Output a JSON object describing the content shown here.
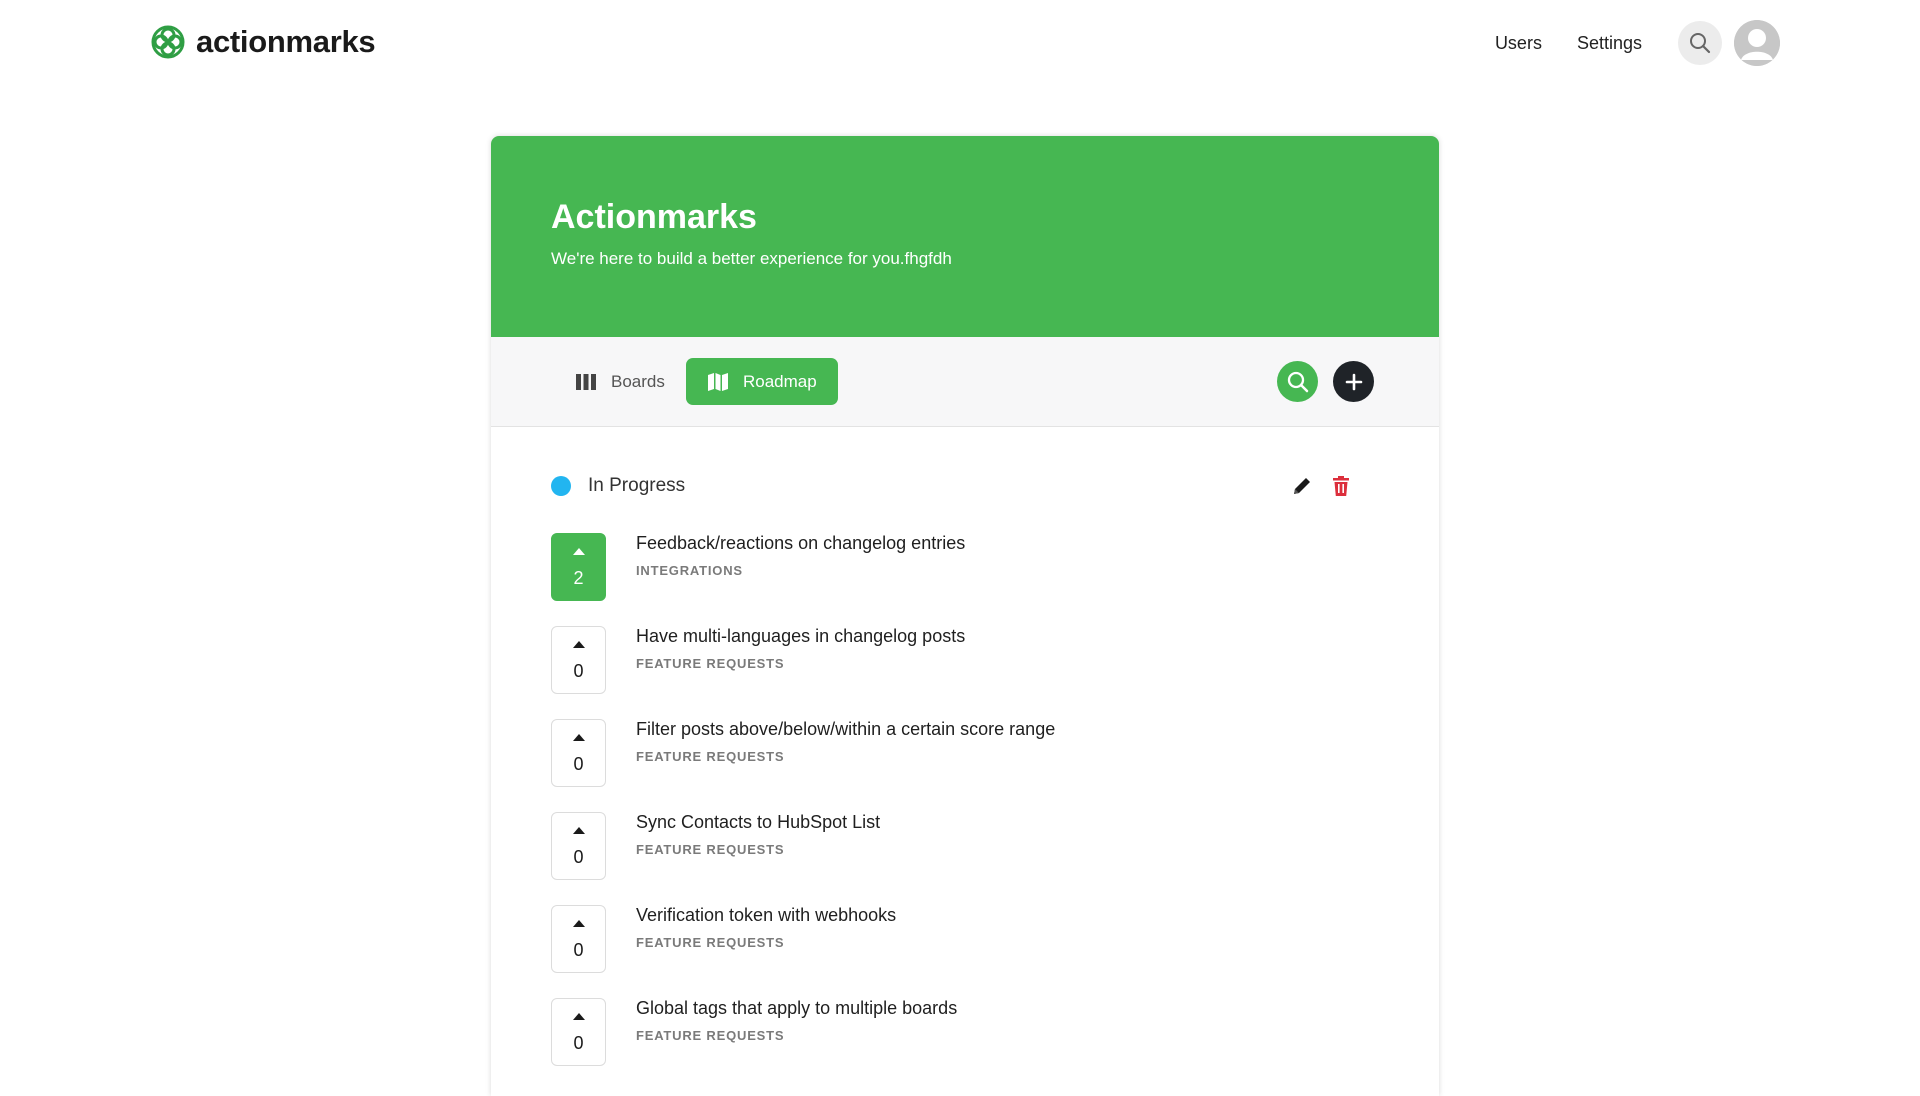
{
  "brand": {
    "name": "actionmarks",
    "logo_icon": "flower-logo-icon",
    "color": "#2f9e44"
  },
  "nav": {
    "users_label": "Users",
    "settings_label": "Settings",
    "search_icon": "search-icon",
    "avatar_icon": "user-avatar-icon"
  },
  "hero": {
    "title": "Actionmarks",
    "subtitle": "We're here to build a better experience for you.fhgfdh",
    "background": "#46b752"
  },
  "toolbar": {
    "tabs": [
      {
        "label": "Boards",
        "icon": "columns-icon",
        "active": false
      },
      {
        "label": "Roadmap",
        "icon": "map-icon",
        "active": true
      }
    ],
    "search_icon": "search-icon",
    "add_icon": "plus-icon"
  },
  "status": {
    "label": "In Progress",
    "color": "#22b5f0",
    "edit_icon": "pencil-icon",
    "delete_icon": "trash-icon"
  },
  "posts": [
    {
      "votes": "2",
      "voted": true,
      "title": "Feedback/reactions on changelog entries",
      "board": "INTEGRATIONS"
    },
    {
      "votes": "0",
      "voted": false,
      "title": "Have multi-languages in changelog posts",
      "board": "FEATURE REQUESTS"
    },
    {
      "votes": "0",
      "voted": false,
      "title": "Filter posts above/below/within a certain score range",
      "board": "FEATURE REQUESTS"
    },
    {
      "votes": "0",
      "voted": false,
      "title": "Sync Contacts to HubSpot List",
      "board": "FEATURE REQUESTS"
    },
    {
      "votes": "0",
      "voted": false,
      "title": "Verification token with webhooks",
      "board": "FEATURE REQUESTS"
    },
    {
      "votes": "0",
      "voted": false,
      "title": "Global tags that apply to multiple boards",
      "board": "FEATURE REQUESTS"
    }
  ]
}
